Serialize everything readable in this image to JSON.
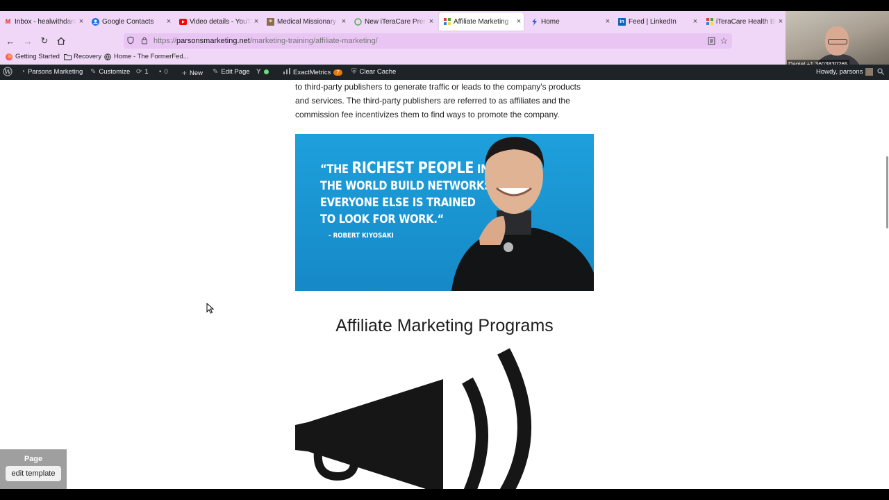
{
  "browser": {
    "tabs": [
      {
        "label": "Inbox - healwithdaniel",
        "icon": "gmail-icon",
        "active": false
      },
      {
        "label": "Google Contacts",
        "icon": "google-contacts-icon",
        "active": false
      },
      {
        "label": "Video details - YouTube",
        "icon": "youtube-icon",
        "active": false
      },
      {
        "label": "Medical Missionary",
        "icon": "image-icon",
        "active": false
      },
      {
        "label": "New iTeraCare Premium",
        "icon": "leaf-icon",
        "active": false
      },
      {
        "label": "Affiliate Marketing - P",
        "icon": "grid-icon",
        "active": true
      },
      {
        "label": "Home",
        "icon": "bolt-icon",
        "active": false
      },
      {
        "label": "Feed | LinkedIn",
        "icon": "linkedin-icon",
        "active": false
      },
      {
        "label": "iTeraCare Health Blow",
        "icon": "grid-icon",
        "active": false
      }
    ],
    "url": {
      "scheme": "https://",
      "host": "parsonsmarketing.net",
      "path": "/marketing-training/affiliate-marketing/"
    },
    "bookmarks": [
      {
        "label": "Getting Started",
        "icon": "firefox-icon"
      },
      {
        "label": "Recovery",
        "icon": "folder-icon"
      },
      {
        "label": "Home - The FormerFed...",
        "icon": "globe-icon"
      }
    ]
  },
  "webcam": {
    "caption": "Daniel +1 3603830265"
  },
  "admin_bar": {
    "site_name": "Parsons Marketing",
    "customize": "Customize",
    "updates_count": "1",
    "comments_count": "0",
    "new": "New",
    "edit_page": "Edit Page",
    "exactmetrics": "ExactMetrics",
    "exactmetrics_badge": "7",
    "clear_cache": "Clear Cache",
    "howdy": "Howdy, parsons"
  },
  "page": {
    "paragraph_lines": [
      "to third-party publishers to generate traffic or leads to the company's products",
      "and services. The third-party publishers are referred to as affiliates and the",
      "commission fee incentivizes them to find ways to promote the company."
    ],
    "hero_quote": {
      "line1_open": "“THE",
      "line1_big": "RICHEST PEOPLE",
      "line1_end": "IN",
      "line2": "THE WORLD BUILD NETWORKS",
      "line3": "EVERYONE ELSE IS TRAINED",
      "line4": "TO LOOK FOR WORK.“",
      "author": "- ROBERT KIYOSAKI"
    },
    "section_heading": "Affiliate Marketing Programs"
  },
  "edit_panel": {
    "label": "Page",
    "button": "edit template"
  },
  "colors": {
    "tab_strip": "#f0d6f7",
    "admin_bar": "#1d2327",
    "hero_blue": "#1ea0dc"
  }
}
